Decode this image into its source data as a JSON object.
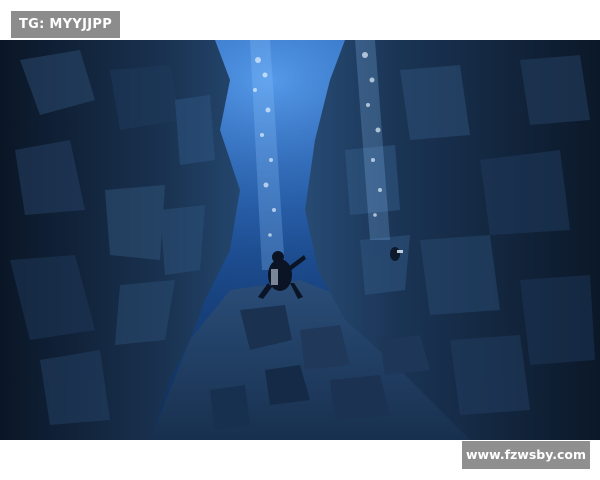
{
  "overlays": {
    "top_tag": "TG: MYYJJPP",
    "watermark": "www.fzwsby.com"
  },
  "colors": {
    "water_light": "#2f6fc4",
    "water_deep": "#0a1f3f",
    "rock_dark": "#0d1a2c",
    "label_background": "#8c8c8c"
  }
}
